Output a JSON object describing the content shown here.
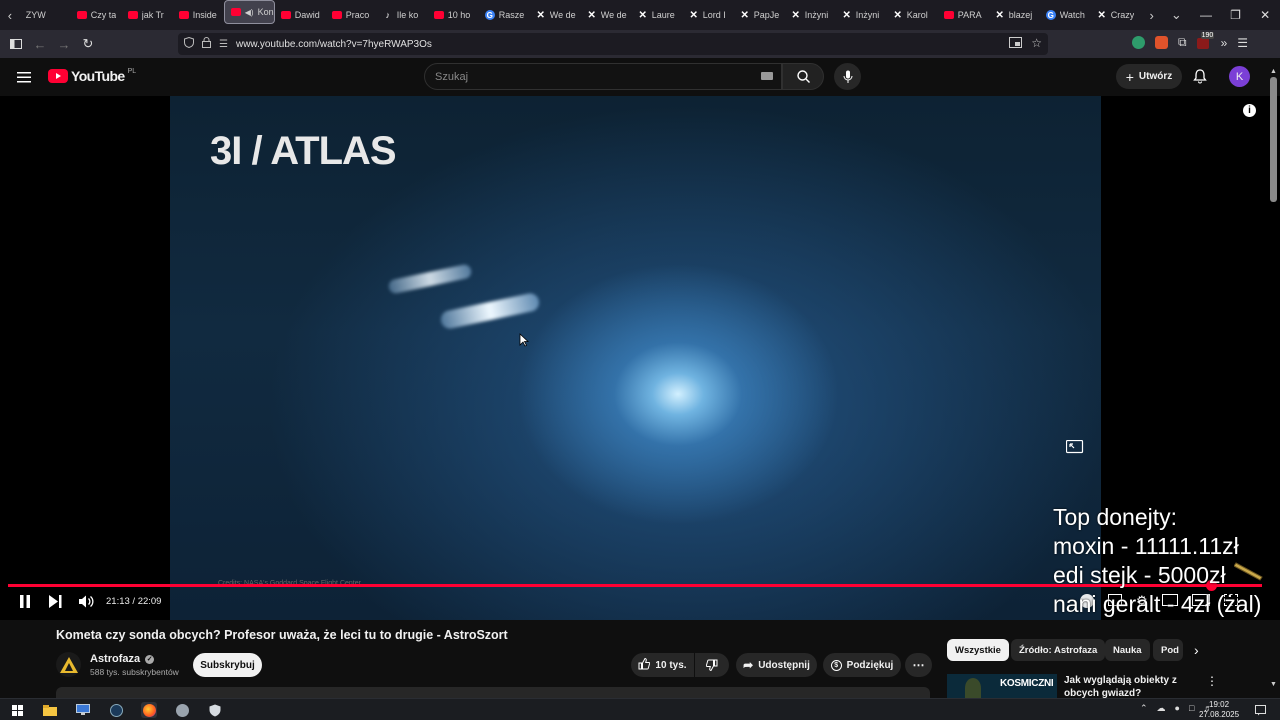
{
  "browser": {
    "tabs": [
      {
        "label": "ZYW",
        "icon": "none"
      },
      {
        "label": "Czy ta",
        "icon": "youtube"
      },
      {
        "label": "jak Tr",
        "icon": "youtube"
      },
      {
        "label": "Inside",
        "icon": "youtube"
      },
      {
        "label": "Kon",
        "icon": "youtube",
        "active": true
      },
      {
        "label": "Dawid",
        "icon": "youtube"
      },
      {
        "label": "Praco",
        "icon": "youtube"
      },
      {
        "label": "Ile ko",
        "icon": "tiktok"
      },
      {
        "label": "10 ho",
        "icon": "youtube"
      },
      {
        "label": "Rasze",
        "icon": "go"
      },
      {
        "label": "We de",
        "icon": "x"
      },
      {
        "label": "We de",
        "icon": "x"
      },
      {
        "label": "Laure",
        "icon": "x"
      },
      {
        "label": "Lord I",
        "icon": "x"
      },
      {
        "label": "PapJe",
        "icon": "x"
      },
      {
        "label": "Inżyni",
        "icon": "x"
      },
      {
        "label": "Inżyni",
        "icon": "x"
      },
      {
        "label": "Karol",
        "icon": "x"
      },
      {
        "label": "PARA",
        "icon": "youtube"
      },
      {
        "label": "blazej",
        "icon": "x"
      },
      {
        "label": "Watch",
        "icon": "go"
      },
      {
        "label": "Crazy",
        "icon": "x"
      }
    ],
    "url": "www.youtube.com/watch?v=7hyeRWAP3Os",
    "extension_badge": "190"
  },
  "youtube": {
    "logo_text": "YouTube",
    "region": "PL",
    "search_placeholder": "Szukaj",
    "create_label": "Utwórz",
    "avatar_letter": "K"
  },
  "video": {
    "overlay_title": "3I / ATLAS",
    "credit": "Credits: NASA's Goddard Space Flight Center",
    "time": "21:13 / 22:09",
    "progress_fraction": 0.959,
    "donations": {
      "heading": "Top donejty:",
      "lines": [
        "moxin - 11111.11zł",
        "edi stejk - 5000zł",
        "nani geralt - 4zł (żal)"
      ]
    }
  },
  "details": {
    "title": "Kometa czy sonda obcych? Profesor uważa, że leci tu to drugie - AstroSzort",
    "channel": "Astrofaza",
    "subscribers": "588 tys. subskrybentów",
    "subscribe_label": "Subskrybuj",
    "likes": "10 tys.",
    "share_label": "Udostępnij",
    "thanks_label": "Podziękuj"
  },
  "chips": [
    "Wszystkie",
    "Źródło: Astrofaza",
    "Nauka",
    "Pod"
  ],
  "recommendation": {
    "thumb_text": "KOSMICZNI",
    "title": "Jak wyglądają obiekty z obcych gwiazd?"
  },
  "taskbar": {
    "time": "19:02",
    "date": "27.08.2025"
  }
}
